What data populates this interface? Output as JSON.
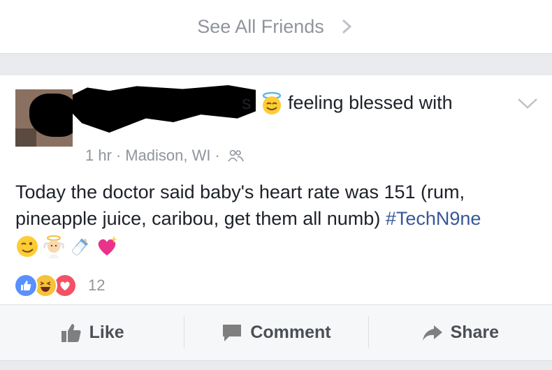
{
  "friends": {
    "see_all_label": "See All Friends",
    "chevron_icon": "chevron-right-icon"
  },
  "post": {
    "name_fragment": "s",
    "feeling_icon": "halo-smile-emoji-icon",
    "feeling_text": "feeling blessed with",
    "time": "1 hr",
    "separator": "·",
    "location": "Madison, WI",
    "privacy_icon": "friends-icon",
    "body": "Today the doctor said baby's heart rate was 151 (rum, pineapple juice, caribou, get them all numb)",
    "hashtag": "#TechN9ne",
    "emojis": [
      "wink-emoji-icon",
      "baby-angel-emoji-icon",
      "baby-bottle-emoji-icon",
      "sparkling-heart-emoji-icon"
    ],
    "reactions": [
      "like-reaction-icon",
      "haha-reaction-icon",
      "love-reaction-icon"
    ],
    "reaction_count": "12",
    "hashtag_color": "#365899"
  },
  "actions": {
    "like": "Like",
    "comment": "Comment",
    "share": "Share"
  }
}
